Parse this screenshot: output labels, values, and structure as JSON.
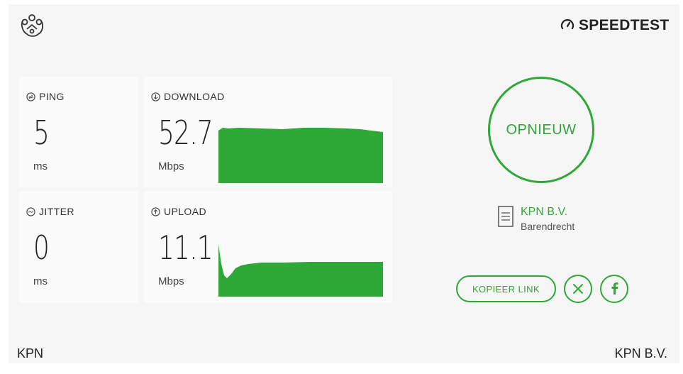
{
  "brand": {
    "speedtest_label": "SPEEDTEST"
  },
  "metrics": {
    "ping": {
      "label": "PING",
      "value": "5",
      "unit": "ms"
    },
    "jitter": {
      "label": "JITTER",
      "value": "0",
      "unit": "ms"
    },
    "download": {
      "label": "DOWNLOAD",
      "value": "52.7",
      "unit": "Mbps"
    },
    "upload": {
      "label": "UPLOAD",
      "value": "11.1",
      "unit": "Mbps"
    }
  },
  "actions": {
    "restart_label": "OPNIEUW",
    "copy_link_label": "KOPIEER LINK",
    "x_icon": "x-icon",
    "facebook_icon": "facebook-icon"
  },
  "server": {
    "isp": "KPN B.V.",
    "location": "Barendrecht"
  },
  "footer": {
    "left": "KPN",
    "right": "KPN B.V."
  },
  "colors": {
    "accent": "#2ea836",
    "graph": "#2ea836"
  }
}
